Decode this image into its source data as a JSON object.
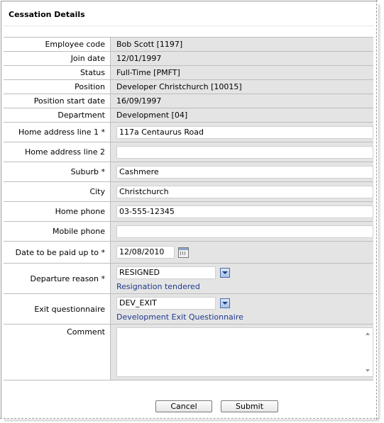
{
  "title": "Cessation Details",
  "fields": {
    "employee_code": {
      "label": "Employee code",
      "value": "Bob Scott [1197]"
    },
    "join_date": {
      "label": "Join date",
      "value": "12/01/1997"
    },
    "status": {
      "label": "Status",
      "value": "Full-Time [PMFT]"
    },
    "position": {
      "label": "Position",
      "value": "Developer Christchurch [10015]"
    },
    "position_start_date": {
      "label": "Position start date",
      "value": "16/09/1997"
    },
    "department": {
      "label": "Department",
      "value": "Development [04]"
    },
    "home_address_1": {
      "label": "Home address line 1 *",
      "value": "117a Centaurus Road"
    },
    "home_address_2": {
      "label": "Home address line 2",
      "value": ""
    },
    "suburb": {
      "label": "Suburb *",
      "value": "Cashmere"
    },
    "city": {
      "label": "City",
      "value": "Christchurch"
    },
    "home_phone": {
      "label": "Home phone",
      "value": "03-555-12345"
    },
    "mobile_phone": {
      "label": "Mobile phone",
      "value": ""
    },
    "paid_up_to": {
      "label": "Date to be paid up to *",
      "value": "12/08/2010"
    },
    "departure_reason": {
      "label": "Departure reason *",
      "value": "RESIGNED",
      "description": "Resignation tendered"
    },
    "exit_questionnaire": {
      "label": "Exit questionnaire",
      "value": "DEV_EXIT",
      "description": "Development Exit Questionnaire"
    },
    "comment": {
      "label": "Comment",
      "value": ""
    }
  },
  "buttons": {
    "cancel": "Cancel",
    "submit": "Submit"
  }
}
